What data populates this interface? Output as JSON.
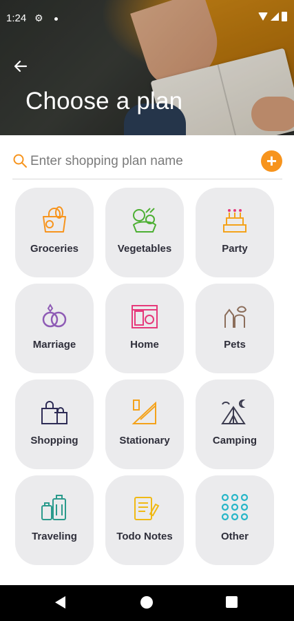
{
  "status_bar": {
    "time": "1:24",
    "icons": [
      "settings-icon",
      "notification-dot",
      "wifi-icon",
      "cell-signal-icon",
      "battery-icon"
    ]
  },
  "header": {
    "title": "Choose a plan",
    "back_icon": "arrow-left-icon"
  },
  "search": {
    "placeholder": "Enter shopping plan name",
    "value": "",
    "add_button_label": "+",
    "accent_color": "#f7941d"
  },
  "plans": [
    {
      "label": "Groceries",
      "icon": "groceries-bag-icon",
      "color": "#f7941d"
    },
    {
      "label": "Vegetables",
      "icon": "vegetables-icon",
      "color": "#4caf32"
    },
    {
      "label": "Party",
      "icon": "cake-icon",
      "color": "#f4a21a"
    },
    {
      "label": "Marriage",
      "icon": "rings-icon",
      "color": "#8e5bb5"
    },
    {
      "label": "Home",
      "icon": "home-appliances-icon",
      "color": "#e6397a"
    },
    {
      "label": "Pets",
      "icon": "pets-icon",
      "color": "#8b6d5a"
    },
    {
      "label": "Shopping",
      "icon": "shopping-bags-icon",
      "color": "#2d2b55"
    },
    {
      "label": "Stationary",
      "icon": "ruler-icon",
      "color": "#f4a21a"
    },
    {
      "label": "Camping",
      "icon": "tent-icon",
      "color": "#3b3b4f"
    },
    {
      "label": "Traveling",
      "icon": "luggage-icon",
      "color": "#2a9a8c"
    },
    {
      "label": "Todo Notes",
      "icon": "notes-icon",
      "color": "#f0b914"
    },
    {
      "label": "Other",
      "icon": "dots-grid-icon",
      "color": "#27b6c7"
    }
  ],
  "nav_bar": {
    "buttons": [
      "back-nav-icon",
      "home-nav-icon",
      "recents-nav-icon"
    ]
  }
}
